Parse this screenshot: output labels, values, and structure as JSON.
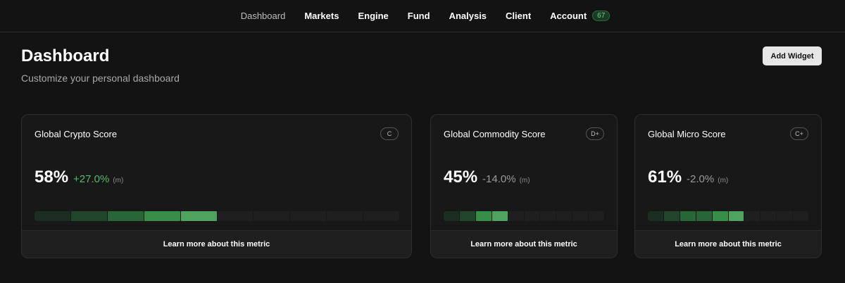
{
  "nav": {
    "items": [
      {
        "label": "Dashboard",
        "active": true
      },
      {
        "label": "Markets"
      },
      {
        "label": "Engine"
      },
      {
        "label": "Fund"
      },
      {
        "label": "Analysis"
      },
      {
        "label": "Client"
      },
      {
        "label": "Account",
        "badge": "67"
      }
    ]
  },
  "header": {
    "title": "Dashboard",
    "subtitle": "Customize your personal dashboard",
    "add_widget_label": "Add Widget"
  },
  "colors": {
    "background": "#131313",
    "accent_green": "#55b86a",
    "segment_empty": "#1f1f1f",
    "segment_shades": [
      "#1c2e21",
      "#21452b",
      "#286637",
      "#378e48",
      "#4ea35f"
    ]
  },
  "cards": [
    {
      "title": "Global Crypto Score",
      "grade": "C",
      "value": "58%",
      "delta": "+27.0%",
      "delta_sign": "pos",
      "period": "(m)",
      "segments_total": 10,
      "segments_filled": 5,
      "footer": "Learn more about this metric"
    },
    {
      "title": "Global Commodity Score",
      "grade": "D+",
      "value": "45%",
      "delta": "-14.0%",
      "delta_sign": "neg",
      "period": "(m)",
      "segments_total": 10,
      "segments_filled": 4,
      "footer": "Learn more about this metric"
    },
    {
      "title": "Global Micro Score",
      "grade": "C+",
      "value": "61%",
      "delta": "-2.0%",
      "delta_sign": "neg",
      "period": "(m)",
      "segments_total": 10,
      "segments_filled": 6,
      "footer": "Learn more about this metric"
    }
  ]
}
